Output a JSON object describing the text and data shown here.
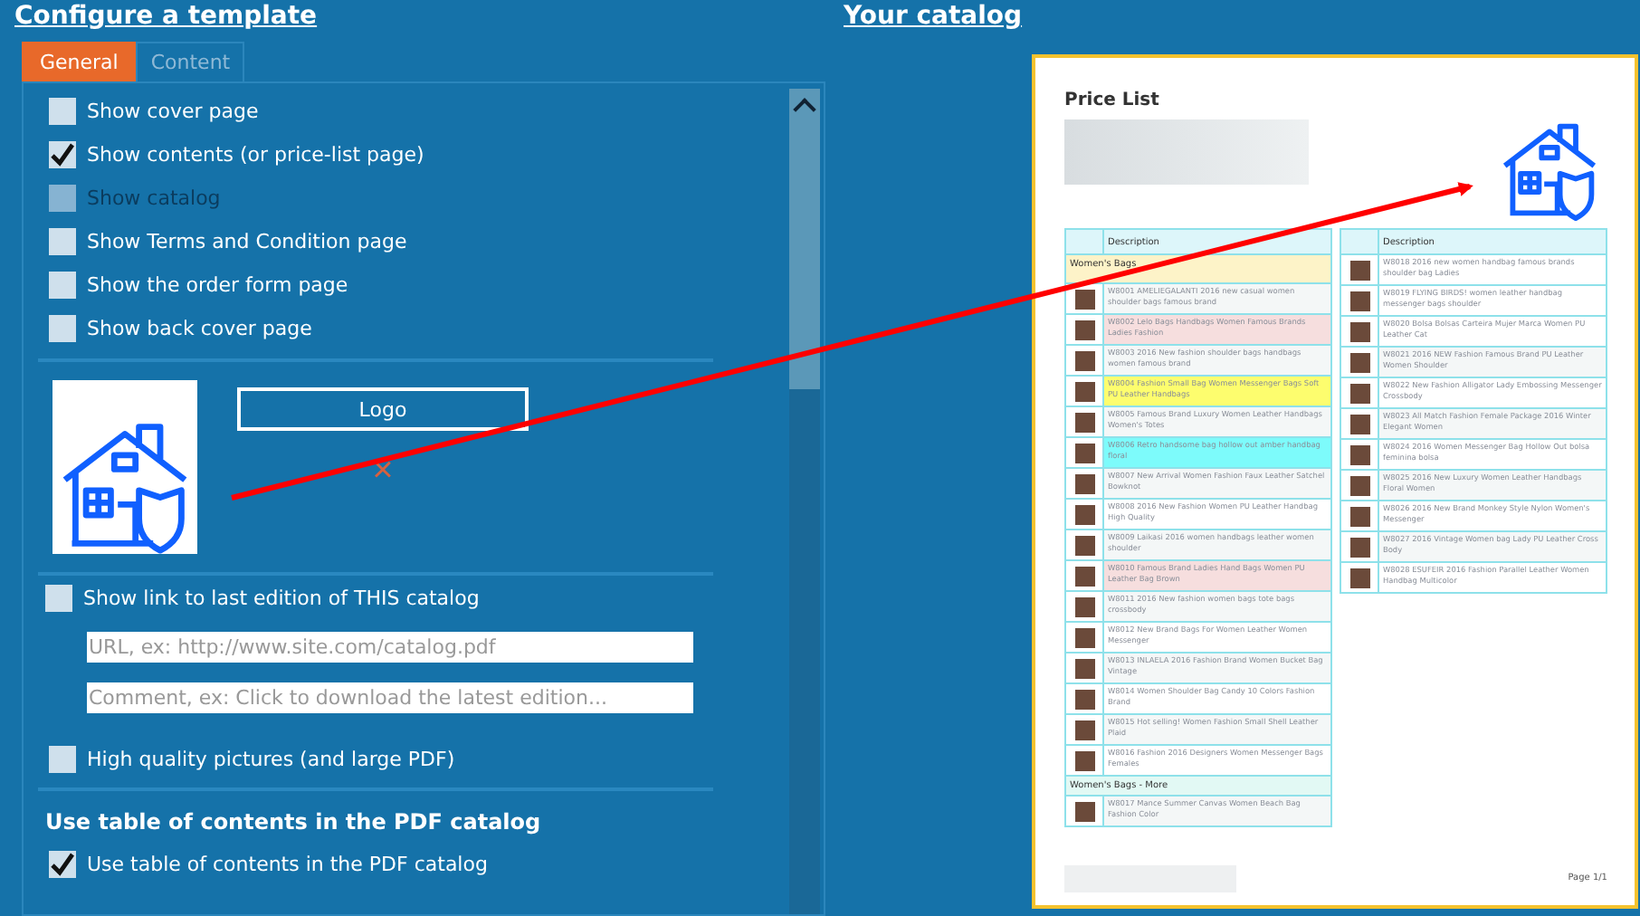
{
  "left_title": "Configure a template",
  "tabs": [
    {
      "label": "General",
      "selected": true
    },
    {
      "label": "Content",
      "selected": false
    }
  ],
  "options": [
    {
      "label": "Show cover page",
      "checked": false,
      "disabled": false
    },
    {
      "label": "Show contents (or price-list page)",
      "checked": true,
      "disabled": false
    },
    {
      "label": "Show catalog",
      "checked": false,
      "disabled": true
    },
    {
      "label": "Show Terms and Condition page",
      "checked": false,
      "disabled": false
    },
    {
      "label": "Show the order form page",
      "checked": false,
      "disabled": false
    },
    {
      "label": "Show back cover page",
      "checked": false,
      "disabled": false
    }
  ],
  "logo": {
    "button": "Logo",
    "remove": "×"
  },
  "link_option": {
    "label": "Show link to last edition of THIS catalog",
    "checked": false
  },
  "link_fields": [
    {
      "placeholder": "URL, ex: http://www.site.com/catalog.pdf"
    },
    {
      "placeholder": "Comment, ex: Click to download the latest edition..."
    }
  ],
  "quality_option": {
    "label": "High quality pictures (and large PDF)",
    "checked": false
  },
  "toc_heading": "Use table of contents in the PDF catalog",
  "toc_option": {
    "label": "Use table of contents in the PDF catalog",
    "checked": true
  },
  "right_title": "Your catalog",
  "preview": {
    "title": "Price List",
    "footer": "Page 1/1",
    "tables": [
      {
        "header": "Description",
        "rows": [
          {
            "kind": "group",
            "text": "Women's Bags"
          },
          {
            "kind": "item",
            "color": "#f4f7f7",
            "text": "W8001 AMELIEGALANTI 2016 new casual women shoulder bags famous brand"
          },
          {
            "kind": "item",
            "color": "#f6dede",
            "text": "W8002 Lelo Bags Handbags Women Famous Brands Ladies Fashion"
          },
          {
            "kind": "item",
            "color": "#f4f7f7",
            "text": "W8003 2016 New fashion shoulder bags handbags women famous brand"
          },
          {
            "kind": "item",
            "color": "#fdfd6e",
            "text": "W8004 Fashion Small Bag Women Messenger Bags Soft PU Leather Handbags"
          },
          {
            "kind": "item",
            "color": "#f4f7f7",
            "text": "W8005 Famous Brand Luxury Women Leather Handbags Women's Totes"
          },
          {
            "kind": "item",
            "color": "#7dfbfb",
            "text": "W8006 Retro handsome bag hollow out amber handbag floral"
          },
          {
            "kind": "item",
            "color": "#f4f7f7",
            "text": "W8007 New Arrival Women Fashion Faux Leather Satchel Bowknot"
          },
          {
            "kind": "item",
            "color": "#ffffff",
            "text": "W8008 2016 New Fashion Women PU Leather Handbag High Quality"
          },
          {
            "kind": "item",
            "color": "#f4f7f7",
            "text": "W8009 Laikasi 2016 women handbags leather women shoulder"
          },
          {
            "kind": "item",
            "color": "#f6dede",
            "text": "W8010 Famous Brand Ladies Hand Bags Women PU Leather Bag Brown"
          },
          {
            "kind": "item",
            "color": "#f4f7f7",
            "text": "W8011 2016 New fashion women bags tote bags crossbody"
          },
          {
            "kind": "item",
            "color": "#ffffff",
            "text": "W8012 New Brand Bags For Women Leather Women Messenger"
          },
          {
            "kind": "item",
            "color": "#f4f7f7",
            "text": "W8013 INLAELA 2016 Fashion Brand Women Bucket Bag Vintage"
          },
          {
            "kind": "item",
            "color": "#ffffff",
            "text": "W8014 Women Shoulder Bag Candy 10 Colors Fashion Brand"
          },
          {
            "kind": "item",
            "color": "#f4f7f7",
            "text": "W8015 Hot selling! Women Fashion Small Shell Leather Plaid"
          },
          {
            "kind": "item",
            "color": "#ffffff",
            "text": "W8016 Fashion 2016 Designers Women Messenger Bags Females"
          },
          {
            "kind": "group",
            "text": "Women's Bags - More"
          },
          {
            "kind": "item",
            "color": "#f4f7f7",
            "text": "W8017 Mance Summer Canvas Women Beach Bag Fashion Color"
          }
        ]
      },
      {
        "header": "Description",
        "rows": [
          {
            "kind": "item",
            "color": "#ffffff",
            "text": "W8018 2016 new women handbag famous brands shoulder bag Ladies"
          },
          {
            "kind": "item",
            "color": "#ffffff",
            "text": "W8019 FLYING BIRDS! women leather handbag messenger bags shoulder"
          },
          {
            "kind": "item",
            "color": "#ffffff",
            "text": "W8020 Bolsa Bolsas Carteira Mujer Marca Women PU Leather Cat"
          },
          {
            "kind": "item",
            "color": "#f4f7f7",
            "text": "W8021 2016 NEW Fashion Famous Brand PU Leather Women Shoulder"
          },
          {
            "kind": "item",
            "color": "#ffffff",
            "text": "W8022 New Fashion Alligator Lady Embossing Messenger Crossbody"
          },
          {
            "kind": "item",
            "color": "#f4f7f7",
            "text": "W8023 All Match Fashion Female Package 2016 Winter Elegant Women"
          },
          {
            "kind": "item",
            "color": "#ffffff",
            "text": "W8024 2016 Women Messenger Bag Hollow Out bolsa feminina bolsa"
          },
          {
            "kind": "item",
            "color": "#f4f7f7",
            "text": "W8025 2016 New Luxury Women Leather Handbags Floral Women"
          },
          {
            "kind": "item",
            "color": "#ffffff",
            "text": "W8026 2016 New Brand Monkey Style Nylon Women's Messenger"
          },
          {
            "kind": "item",
            "color": "#f4f7f7",
            "text": "W8027 2016 Vintage Women bag Lady PU Leather Cross Body"
          },
          {
            "kind": "item",
            "color": "#ffffff",
            "text": "W8028 ESUFEIR 2016 Fashion Parallel Leather Women Handbag Multicolor"
          }
        ]
      }
    ]
  }
}
